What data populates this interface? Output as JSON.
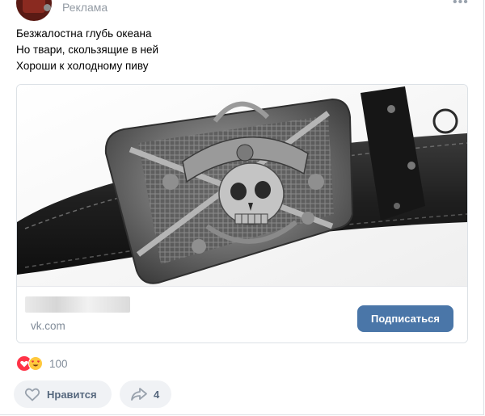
{
  "post": {
    "ad_label": "Реклама",
    "text_lines": [
      "Безжалостна глубь океана",
      "Но твари, скользящие в ней",
      "Хороши к холодному пиву"
    ]
  },
  "ad": {
    "domain": "vk.com",
    "subscribe_label": "Подписаться"
  },
  "reactions": {
    "count": "100",
    "icons": [
      "heart-icon",
      "heart-eyes-emoji-icon"
    ]
  },
  "actions": {
    "like_label": "Нравится",
    "share_count": "4"
  },
  "colors": {
    "accent": "#4a76a8",
    "button_bg": "#f0f2f5",
    "secondary_text": "#818c99"
  }
}
